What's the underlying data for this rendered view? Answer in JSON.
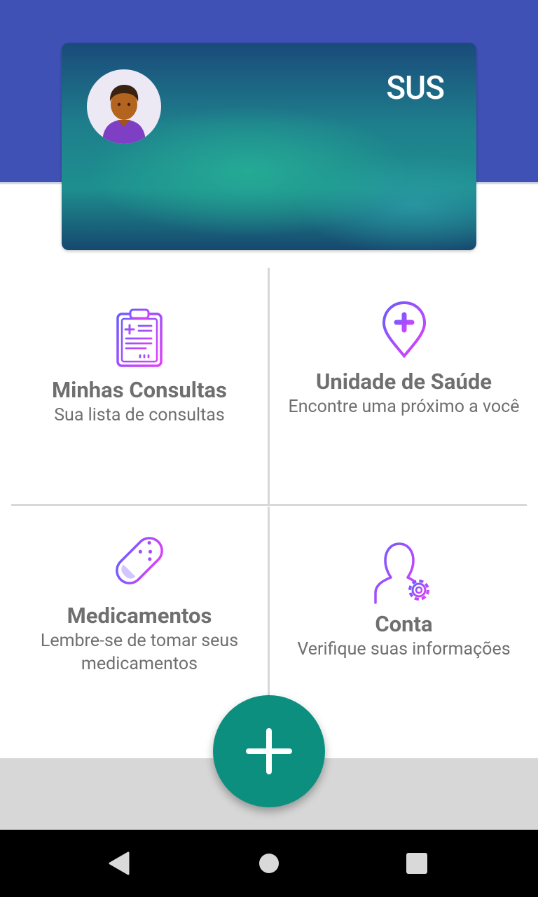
{
  "card": {
    "title": "SUS",
    "avatar_icon": "person-avatar-icon"
  },
  "tiles": [
    {
      "icon": "clipboard-icon",
      "title": "Minhas Consultas",
      "subtitle": "Sua lista de consultas"
    },
    {
      "icon": "map-pin-plus-icon",
      "title": "Unidade de Saúde",
      "subtitle": "Encontre uma próximo a você"
    },
    {
      "icon": "pill-capsule-icon",
      "title": "Medicamentos",
      "subtitle": "Lembre-se de tomar seus medicamentos"
    },
    {
      "icon": "user-settings-icon",
      "title": "Conta",
      "subtitle": "Verifique suas informações"
    }
  ],
  "fab": {
    "icon": "plus-icon"
  },
  "navbar": {
    "back_icon": "back-triangle-icon",
    "home_icon": "home-circle-icon",
    "recents_icon": "recents-square-icon"
  },
  "colors": {
    "header": "#3f51b5",
    "fab": "#0d8f80",
    "icon_gradient_start": "#7c4dff",
    "icon_gradient_end": "#e040fb"
  }
}
